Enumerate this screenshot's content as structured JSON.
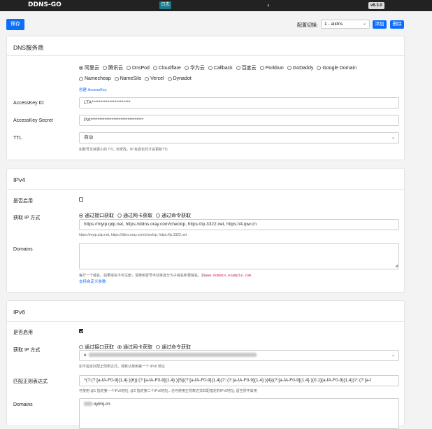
{
  "nav": {
    "brand": "DDNS-GO",
    "log_label": "日志",
    "theme_glyph": "◐",
    "version": "v6.3.0"
  },
  "toolbar": {
    "save_label": "保存",
    "config_label": "配置切换:",
    "config_value": "1 - alidns",
    "add_label": "添加",
    "delete_label": "删除"
  },
  "dns": {
    "title": "DNS服务商",
    "providers_row1": [
      "阿里云",
      "腾讯云",
      "DnsPod",
      "Cloudflare",
      "华为云",
      "Callback",
      "百度云",
      "Porkbun",
      "GoDaddy",
      "Google Domain"
    ],
    "providers_row2": [
      "Namecheap",
      "NameSilo",
      "Vercel",
      "Dynadot"
    ],
    "selected": "阿里云",
    "create_key_link": "创建 AccessKey",
    "id_label": "AccessKey ID",
    "id_value": "LTA**********************",
    "secret_label": "AccessKey Secret",
    "secret_value": "Pzt******************************",
    "ttl_label": "TTL",
    "ttl_value": "自动",
    "ttl_hint": "如账号支持更小的 TTL, 可修改。IP 有变化时才会更新TTL"
  },
  "ipv4": {
    "title": "IPv4",
    "enable_label": "是否启用",
    "enabled": false,
    "method_label": "获取 IP 方式",
    "methods": [
      "通过接口获取",
      "通过网卡获取",
      "通过命令获取"
    ],
    "selected_method": "通过接口获取",
    "url_value": "https://myip.ipip.net, https://ddns.oray.com/checkip, https://ip.3322.net, https://4.ipw.cn",
    "url_hint": "https://myip.ipip.net, https://ddns.oray.com/checkip, https://ip.3322.net",
    "domains_label": "Domains",
    "domains_hint": "每行一个域名。如果域名不可注册，请使用冒号手动将其分为子域名和根域名。如",
    "domains_hint_code": "www:domain.example.com",
    "custom_params_link": "支持自定义参数"
  },
  "ipv6": {
    "title": "IPv6",
    "enable_label": "是否启用",
    "enabled": true,
    "method_label": "获取 IP 方式",
    "methods": [
      "通过接口获取",
      "通过网卡获取",
      "通过命令获取"
    ],
    "selected_method": "通过网卡获取",
    "nic_prefix": "e",
    "nic_hint": "如不指定匹配正则表达式，将默认使用第一个 IPv6 地址",
    "regex_label": "匹配正则表达式",
    "regex_value": "^(?:(?:[a-fA-F0-9]{1,4}:){6}|:(?:[a-fA-F0-9]{1,4}:){5}|(?:[a-fA-F0-9]{1,4})?::(?:[a-fA-F0-9]{1,4}:){4}|(?:[a-fA-F0-9]{1,4}:){0,1}[a-fA-F0-9]{1,4})?::(?:[a-f",
    "regex_hint": "可使用 @1 指定第一个IPv6地址, @2 指定第二个IPv6地址...也可使用正则表达式匹配指定的IPv6地址, 留空则不启用",
    "domains_label": "Domains",
    "domain_value": ".nylmj.cn"
  }
}
